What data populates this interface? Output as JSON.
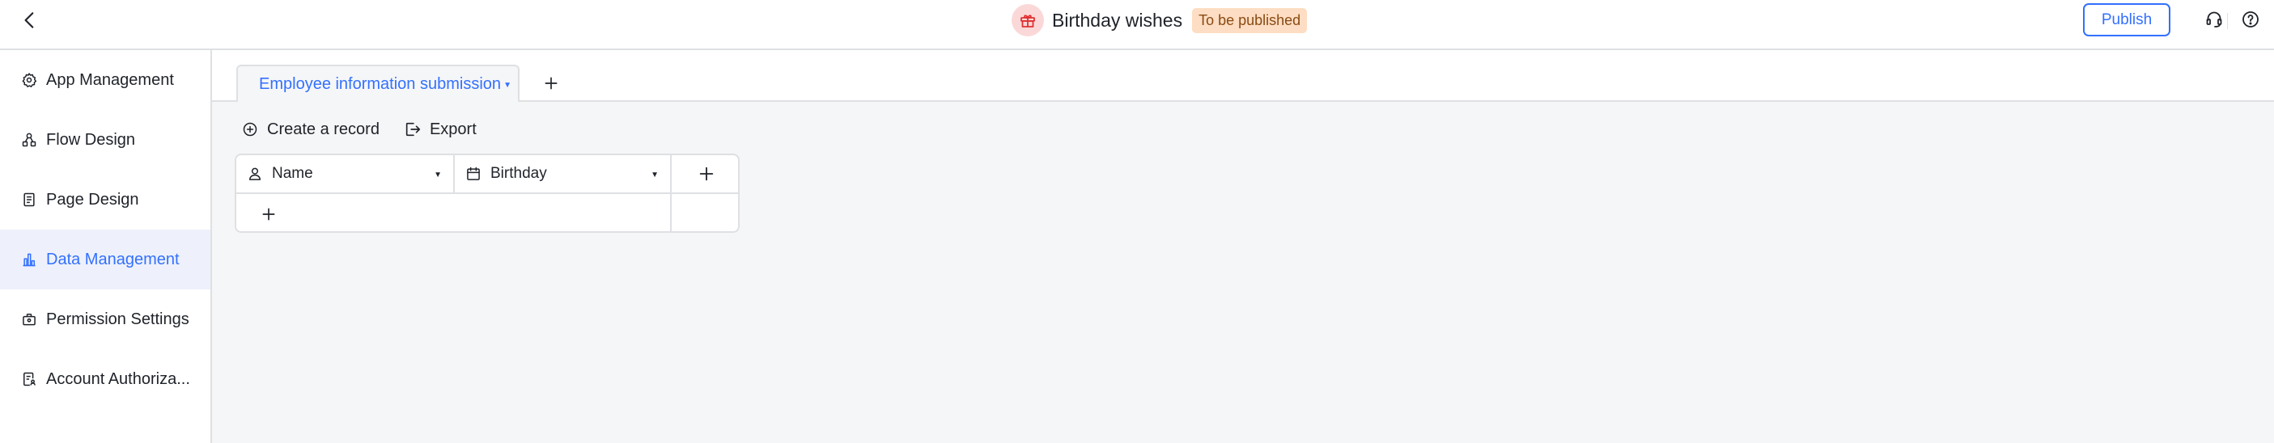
{
  "header": {
    "back_icon": "chevron-left-icon",
    "app_icon": "gift-icon",
    "title": "Birthday wishes",
    "status": "To be published",
    "publish_label": "Publish",
    "support_icon": "headset-icon",
    "help_icon": "help-circle-icon"
  },
  "sidebar": {
    "items": [
      {
        "label": "App Management",
        "icon": "gear-icon"
      },
      {
        "label": "Flow Design",
        "icon": "flow-icon"
      },
      {
        "label": "Page Design",
        "icon": "document-icon"
      },
      {
        "label": "Data Management",
        "icon": "bar-chart-icon",
        "active": true
      },
      {
        "label": "Permission Settings",
        "icon": "lock-briefcase-icon"
      },
      {
        "label": "Account Authoriza...",
        "icon": "account-doc-icon"
      }
    ]
  },
  "main": {
    "tabs": [
      {
        "label": "Employee information submission",
        "active": true
      }
    ],
    "toolbar": {
      "create_label": "Create a record",
      "export_label": "Export"
    },
    "table": {
      "columns": [
        {
          "label": "Name",
          "icon": "person-icon"
        },
        {
          "label": "Birthday",
          "icon": "calendar-icon"
        }
      ]
    }
  },
  "colors": {
    "accent": "#3370ff",
    "active_bg": "#eef1fb",
    "badge_bg": "#fdddc3",
    "app_icon_bg": "#fbd8d8",
    "app_icon_fg": "#e03131",
    "canvas_bg": "#f5f6f7"
  }
}
